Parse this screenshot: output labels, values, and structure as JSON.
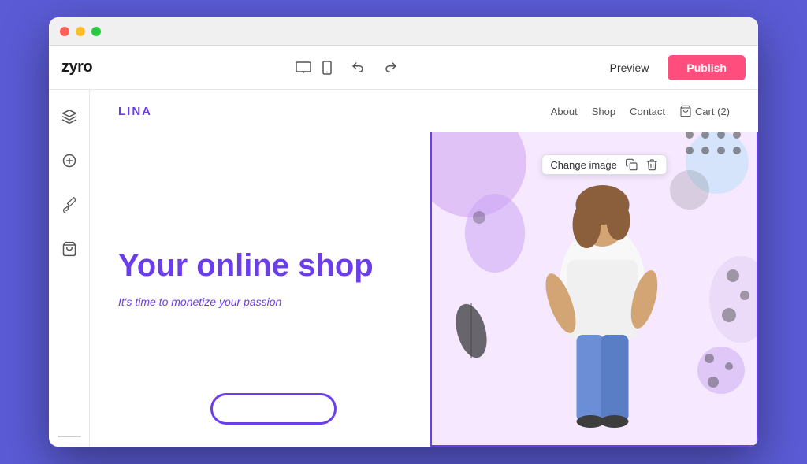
{
  "app": {
    "logo": "zyro",
    "topbar": {
      "preview_label": "Preview",
      "publish_label": "Publish"
    },
    "sidebar": {
      "icons": [
        "layers-icon",
        "add-circle-icon",
        "brush-icon",
        "cart-icon"
      ]
    }
  },
  "site": {
    "logo": "LINA",
    "nav": {
      "links": [
        "About",
        "Shop",
        "Contact"
      ],
      "cart": "Cart (2)"
    },
    "hero": {
      "title": "Your online shop",
      "subtitle": "It's time to monetize your passion"
    },
    "image_toolbar": {
      "label": "Change image"
    }
  },
  "colors": {
    "accent": "#6c3deb",
    "publish": "#ff4d7e",
    "bg": "#5b5bd6"
  }
}
